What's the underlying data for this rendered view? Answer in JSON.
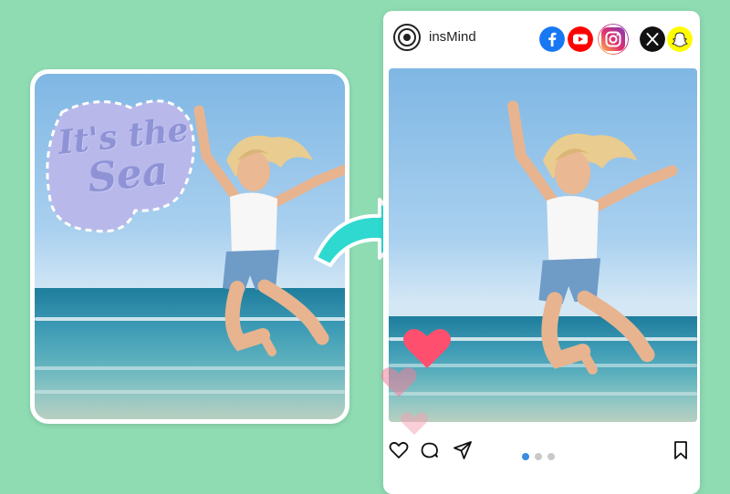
{
  "sticker": {
    "line1": "It's the",
    "line2": "Sea"
  },
  "post": {
    "account_name": "insMind",
    "social_icons": [
      "facebook-icon",
      "youtube-icon",
      "instagram-icon",
      "x-icon",
      "snapchat-icon"
    ],
    "carousel": {
      "total": 3,
      "active": 1
    }
  },
  "colors": {
    "background": "#8fdcb3",
    "arrow": "#2fd9cf",
    "sticker_fill": "#b8b9ea",
    "heart_primary": "#ff4f6e",
    "heart_faded": "#f6a0b4",
    "carousel_active": "#3a8de0"
  }
}
